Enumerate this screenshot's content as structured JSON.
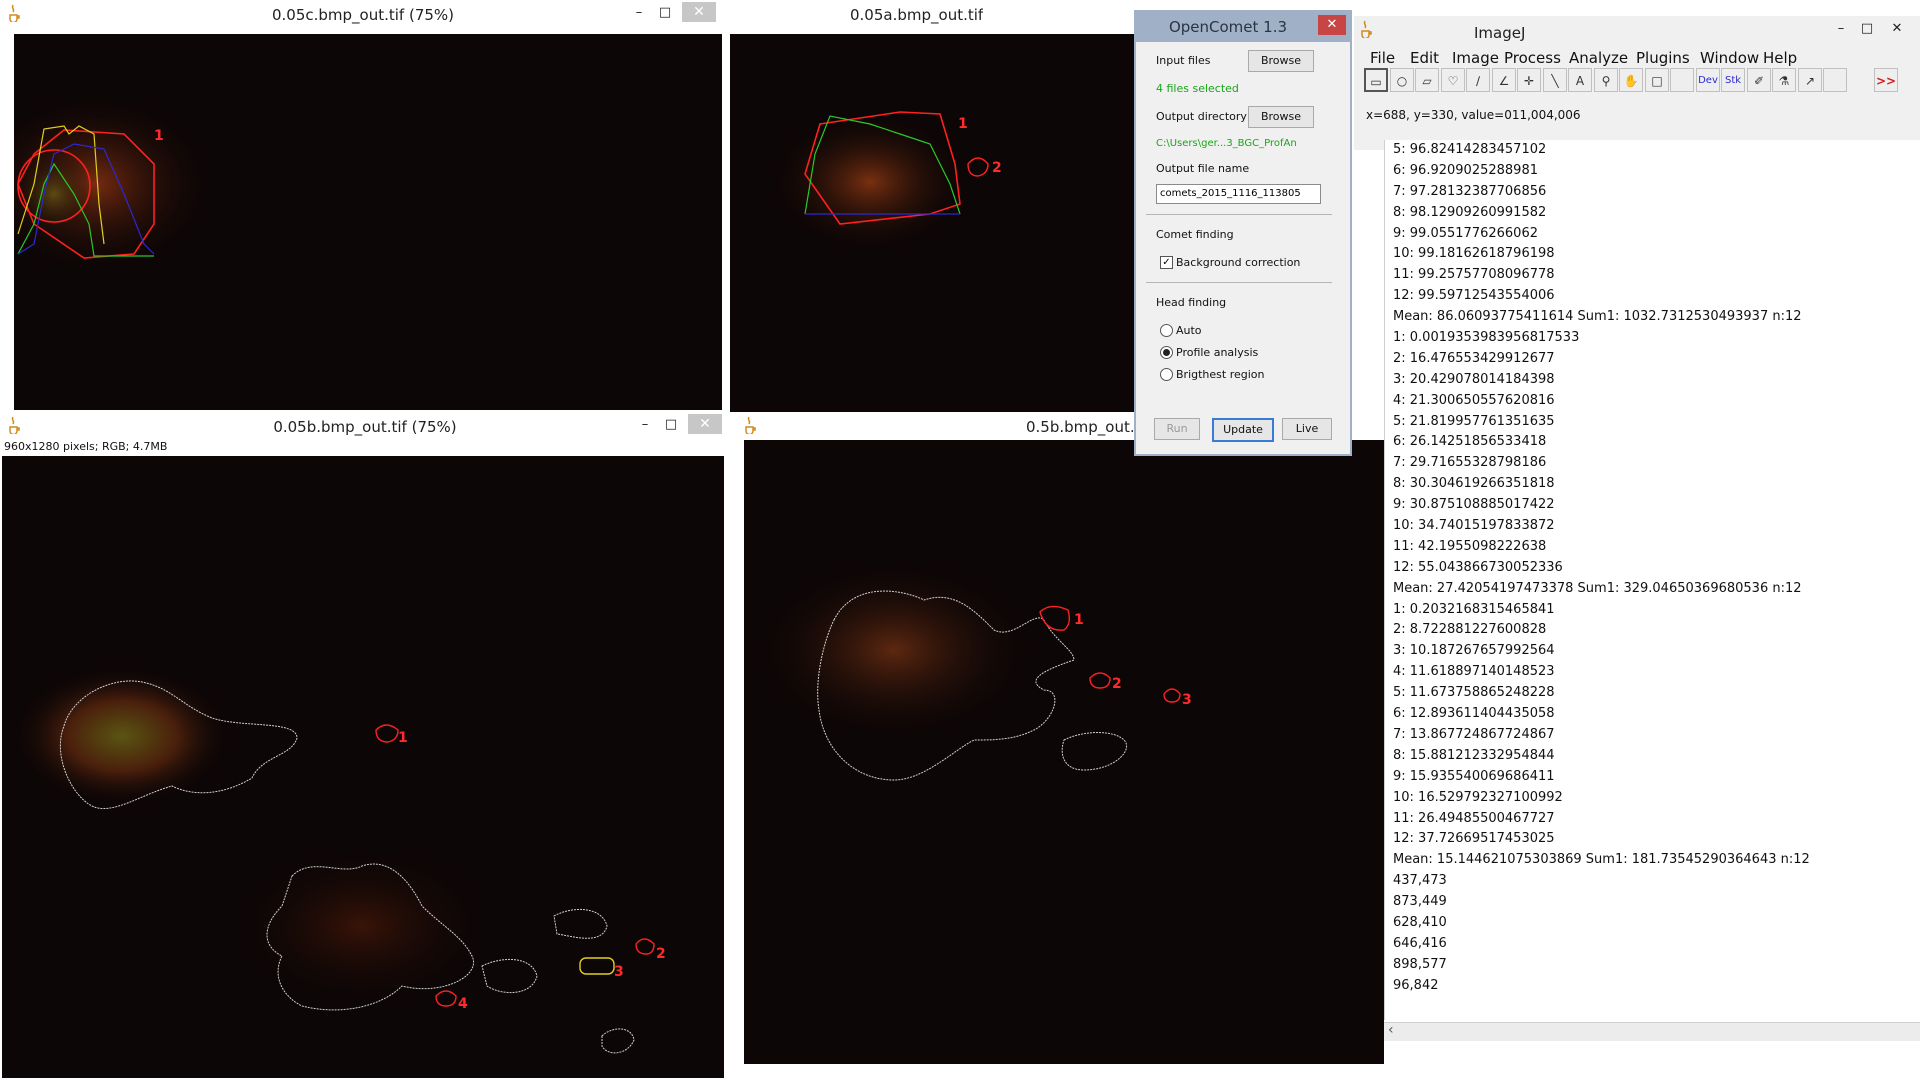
{
  "windows": {
    "top_left": {
      "title": "0.05c.bmp_out.tif (75%)",
      "label_1": "1"
    },
    "top_mid": {
      "title": "0.05a.bmp_out.tif",
      "label_1": "1",
      "label_2": "2"
    },
    "bottom_left": {
      "title": "0.05b.bmp_out.tif (75%)",
      "info": "960x1280 pixels; RGB; 4.7MB",
      "labels": [
        "1",
        "2",
        "3",
        "4"
      ]
    },
    "bottom_mid": {
      "title": "0.5b.bmp_out.tif",
      "labels": [
        "1",
        "2",
        "3"
      ]
    },
    "minimize_glyph": "–",
    "maximize_glyph": "□",
    "close_glyph": "✕"
  },
  "opencomet": {
    "title": "OpenComet 1.3",
    "input_files_label": "Input files",
    "browse_label": "Browse",
    "files_selected": "4 files selected",
    "output_dir_label": "Output directory",
    "output_dir_value": "C:\\Users\\ger...3_BGC_ProfAn",
    "output_file_label": "Output file name",
    "output_file_value": "comets_2015_1116_113805",
    "comet_finding": "Comet finding",
    "background_correction": "Background correction",
    "head_finding": "Head finding",
    "auto": "Auto",
    "profile_analysis": "Profile analysis",
    "brightest_region": "Brigthest region",
    "run": "Run",
    "update": "Update",
    "live": "Live"
  },
  "imagej": {
    "title": "ImageJ",
    "menu": [
      "File",
      "Edit",
      "Image",
      "Process",
      "Analyze",
      "Plugins",
      "Window",
      "Help"
    ],
    "tools": [
      "▭",
      "○",
      "▱",
      "♡",
      "∕",
      "∠",
      "✛",
      "╲",
      "A",
      "⚲",
      "✋",
      "□",
      "",
      "Dev",
      "Stk",
      "✐",
      "⚗",
      "↗",
      "",
      ">>"
    ],
    "status": "x=688, y=330, value=011,004,006"
  },
  "log": [
    "5: 96.82414283457102",
    "6: 96.9209025288981",
    "7: 97.28132387706856",
    "8: 98.12909260991582",
    "9: 99.0551776266062",
    "10: 99.18162618796198",
    "11: 99.25757708096778",
    "12: 99.59712543554006",
    "Mean: 86.06093775411614 Sum1: 1032.7312530493937 n:12",
    "1: 0.0019353983956817533",
    "2: 16.476553429912677",
    "3: 20.429078014184398",
    "4: 21.300650557620816",
    "5: 21.819957761351635",
    "6: 26.14251856533418",
    "7: 29.71655328798186",
    "8: 30.304619266351818",
    "9: 30.875108885017422",
    "10: 34.74015197833872",
    "11: 42.1955098222638",
    "12: 55.043866730052336",
    "Mean: 27.42054197473378 Sum1: 329.04650369680536 n:12",
    "1: 0.2032168315465841",
    "2: 8.722881227600828",
    "3: 10.187267657992564",
    "4: 11.618897140148523",
    "5: 11.673758865248228",
    "6: 12.893611404435058",
    "7: 13.867724867724867",
    "8: 15.881212332954844",
    "9: 15.935540069686411",
    "10: 16.529792327100992",
    "11: 26.49485500467727",
    "12: 37.72669517453025",
    "Mean: 15.144621075303869 Sum1: 181.73545290364643 n:12",
    "437,473",
    "873,449",
    "628,410",
    "646,416",
    "898,577",
    "96,842"
  ],
  "scroll_left_arrow": "‹"
}
